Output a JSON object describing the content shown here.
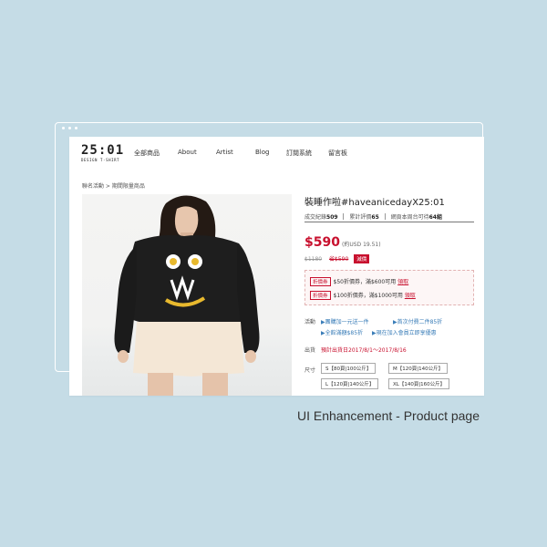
{
  "logo": {
    "main": "25:01",
    "sub": "DESIGN T-SHIRT"
  },
  "nav": [
    "全部商品",
    "About",
    "Artist",
    "Blog",
    "訂閱系統",
    "留言板"
  ],
  "breadcrumb": "聯名活動 > 期間限量商品",
  "product": {
    "title": "裝睡作啦#haveanicedayX25:01",
    "stats": {
      "sold_label": "成交紀錄",
      "sold_value": "509",
      "review_label": "累計評價",
      "review_value": "65",
      "stock_label": "網頁本周台可待",
      "stock_value": "64組"
    },
    "price": "$590",
    "usd": "(約USD 19.51)",
    "original_price": "$1180",
    "save": "省$590",
    "promo_tag": "減價"
  },
  "coupons": [
    {
      "tag": "折價券",
      "text": "$50折價券，滿$600可用",
      "link": "領取"
    },
    {
      "tag": "折價券",
      "text": "$100折價券，滿$1000可用",
      "link": "領取"
    }
  ],
  "events": {
    "label": "活動",
    "items": [
      "▶團購加一元送一件",
      "▶首次付費二件85折",
      "▶全館滿額$85折",
      "▶現在加入會員立即享優惠"
    ]
  },
  "shipping": {
    "label": "出貨",
    "text": "預計出貨日2017/8/1～2017/8/16"
  },
  "sizes": {
    "label": "尺寸",
    "options": [
      "S【80頁|100公斤】",
      "M【120頁|140公斤】",
      "L【120頁|140公斤】",
      "XL【140頁|160公斤】"
    ]
  },
  "caption": "UI Enhancement - Product page",
  "colors": {
    "accent": "#c8102e",
    "link": "#3a7db8",
    "background": "#c5dce6"
  }
}
